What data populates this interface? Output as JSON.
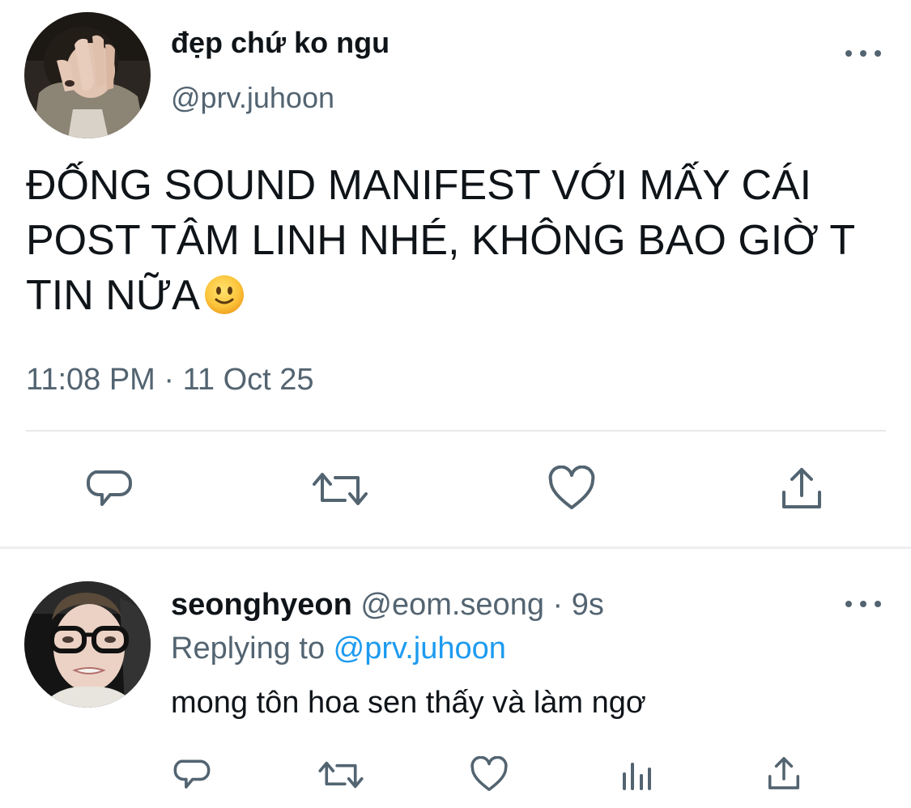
{
  "main_tweet": {
    "display_name": "đẹp chứ ko ngu",
    "handle": "@prv.juhoon",
    "text": "ĐỐNG SOUND MANIFEST VỚI MẤY CÁI\nPOST TÂM LINH NHÉ, KHÔNG BAO GIỜ T\nTIN NỮA",
    "emoji": "slightly-smiling-face",
    "timestamp": "11:08 PM · 11 Oct 25",
    "actions": [
      "reply-icon",
      "retweet-icon",
      "like-icon",
      "share-icon"
    ]
  },
  "reply_tweet": {
    "display_name": "seonghyeon",
    "handle_time": " @eom.seong · 9s",
    "replying_prefix": "Replying to ",
    "replying_to": "@prv.juhoon",
    "text": "mong tôn hoa sen thấy và làm ngơ",
    "actions": [
      "reply-icon",
      "retweet-icon",
      "like-icon",
      "analytics-icon",
      "share-icon"
    ]
  },
  "colors": {
    "text_primary": "#0f1419",
    "text_secondary": "#536471",
    "link": "#1d9bf0",
    "icon": "#536471",
    "divider": "#e6e9eb"
  }
}
